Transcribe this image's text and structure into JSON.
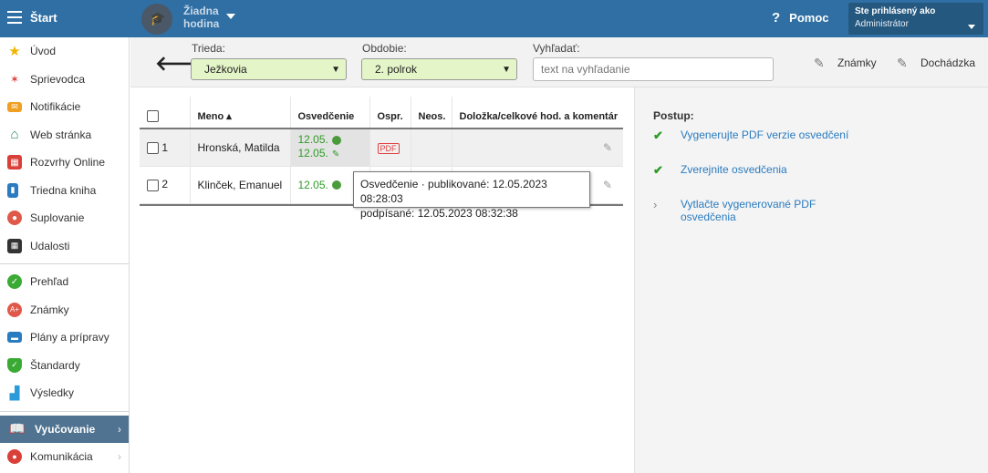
{
  "topbar": {
    "start_label": "Štart",
    "hour_line1": "Žiadna",
    "hour_line2": "hodina",
    "help_label": "Pomoc",
    "user_line1": "Ste prihlásený ako",
    "user_line2": "Administrátor"
  },
  "sidebar": {
    "items": [
      {
        "label": "Úvod",
        "icon": "star-icon"
      },
      {
        "label": "Sprievodca",
        "icon": "wand-icon"
      },
      {
        "label": "Notifikácie",
        "icon": "envelope-icon"
      },
      {
        "label": "Web stránka",
        "icon": "house-icon"
      },
      {
        "label": "Rozvrhy Online",
        "icon": "calendar-grid-icon"
      },
      {
        "label": "Triedna kniha",
        "icon": "book-icon"
      },
      {
        "label": "Suplovanie",
        "icon": "person-icon"
      },
      {
        "label": "Udalosti",
        "icon": "calendar-icon"
      },
      {
        "label": "Prehľad",
        "icon": "check-circle-icon"
      },
      {
        "label": "Známky",
        "icon": "grade-icon"
      },
      {
        "label": "Plány a prípravy",
        "icon": "briefcase-icon"
      },
      {
        "label": "Štandardy",
        "icon": "shield-icon"
      },
      {
        "label": "Výsledky",
        "icon": "bar-chart-icon"
      },
      {
        "label": "Vyučovanie",
        "icon": "open-book-icon"
      },
      {
        "label": "Komunikácia",
        "icon": "chat-icon"
      }
    ]
  },
  "filters": {
    "class_label": "Trieda:",
    "class_value": "Ježkovia",
    "period_label": "Obdobie:",
    "period_value": "2. polrok",
    "search_label": "Vyhľadať:",
    "search_placeholder": "text na vyhľadanie",
    "grades_button": "Známky",
    "attendance_button": "Dochádzka"
  },
  "table": {
    "headers": {
      "name": "Meno ▴",
      "certificate": "Osvedčenie",
      "excused": "Ospr.",
      "unexcused": "Neos.",
      "comment": "Doložka/celkové hod. a komentár"
    },
    "rows": [
      {
        "num": "1",
        "name": "Hronská, Matilda",
        "cert1": "12.05.",
        "cert2": "12.05."
      },
      {
        "num": "2",
        "name": "Klinček, Emanuel",
        "cert1": "12.05."
      }
    ]
  },
  "tooltip": {
    "line1": "Osvedčenie · publikované: 12.05.2023 08:28:03",
    "line2": "podpísané: 12.05.2023 08:32:38"
  },
  "right_panel": {
    "title": "Postup:",
    "steps": [
      {
        "label": "Vygenerujte PDF verzie osvedčení",
        "status": "done"
      },
      {
        "label": "Zverejnite osvedčenia",
        "status": "done"
      },
      {
        "label": "Vytlačte vygenerované PDF osvedčenia",
        "status": "next"
      }
    ]
  }
}
